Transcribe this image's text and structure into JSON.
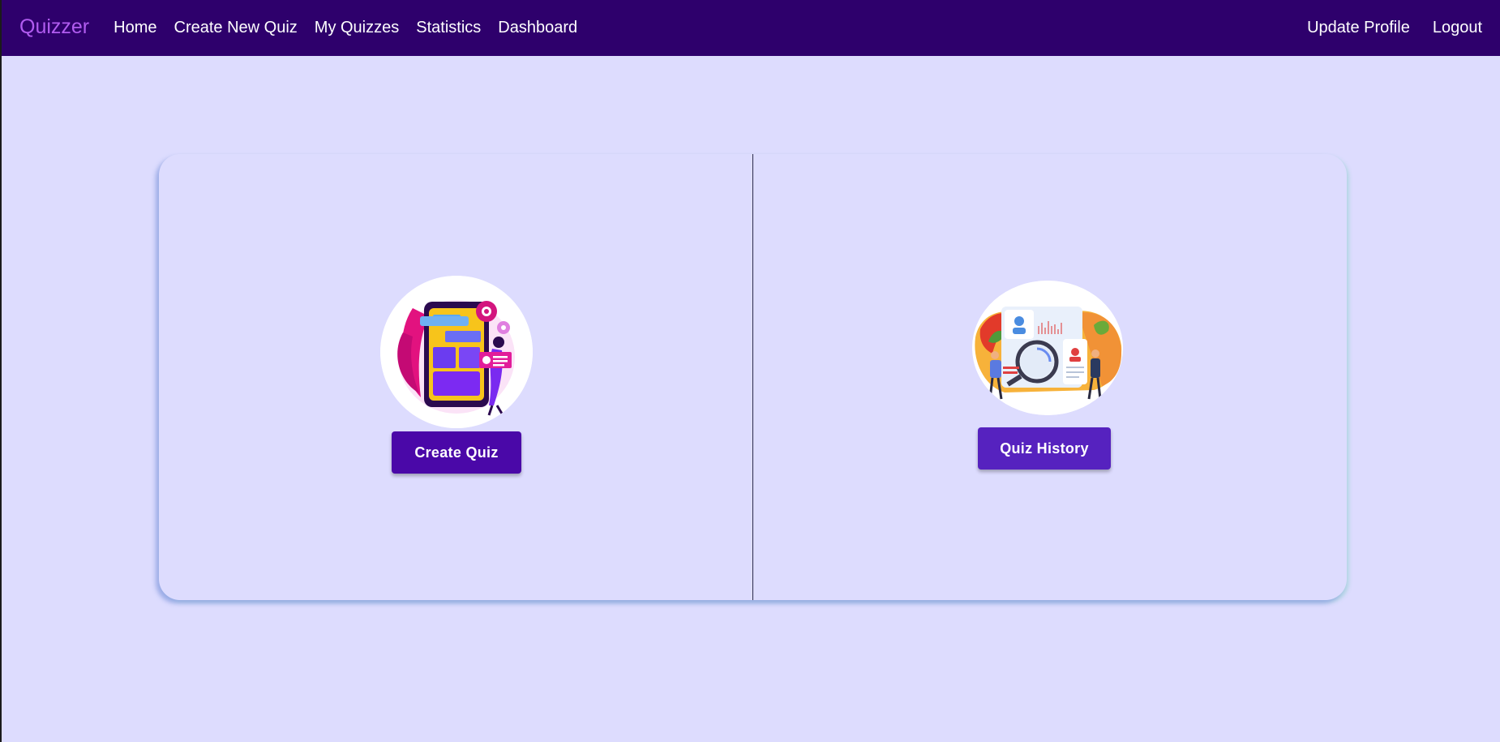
{
  "navbar": {
    "brand": "Quizzer",
    "links": [
      {
        "label": "Home"
      },
      {
        "label": "Create New Quiz"
      },
      {
        "label": "My Quizzes"
      },
      {
        "label": "Statistics"
      },
      {
        "label": "Dashboard"
      }
    ],
    "right_links": [
      {
        "label": "Update Profile"
      },
      {
        "label": "Logout"
      }
    ]
  },
  "main": {
    "left_panel": {
      "illustration_icon": "quiz-builder-illustration-icon",
      "button_label": "Create Quiz"
    },
    "right_panel": {
      "illustration_icon": "quiz-analytics-illustration-icon",
      "button_label": "Quiz History"
    }
  },
  "colors": {
    "navbar_bg": "#2e006c",
    "brand": "#b15cf0",
    "page_bg": "#dddcfe",
    "create_button": "#4a08a8",
    "history_button": "#5622bf"
  }
}
